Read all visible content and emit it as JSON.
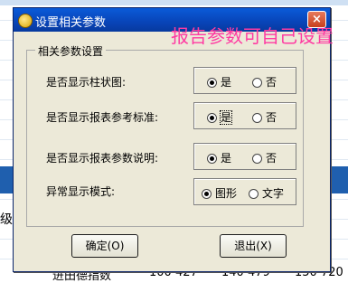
{
  "dialog": {
    "title": "设置相关参数",
    "close_label": "×"
  },
  "overlay_label": "报告参数可自己设置",
  "group": {
    "legend": "相关参数设置",
    "rows": [
      {
        "label": "是否显示柱状图:",
        "options": [
          "是",
          "否"
        ],
        "selected": "是"
      },
      {
        "label": "是否显示报表参考标准:",
        "options": [
          "是",
          "否"
        ],
        "selected": "是"
      },
      {
        "label": "是否显示报表参数说明:",
        "options": [
          "是",
          "否"
        ],
        "selected": "是"
      },
      {
        "label": "异常显示模式:",
        "options": [
          "图形",
          "文字"
        ],
        "selected": "图形"
      }
    ]
  },
  "buttons": {
    "ok_label": "确定(O)",
    "exit_label": "退出(X)"
  },
  "background": {
    "left_char": "级",
    "bottom_text_1": "进田德指数",
    "bottom_text_2": "100 427",
    "bottom_text_3": "140 479",
    "bottom_text_4": "150 720"
  },
  "colors": {
    "title_bar": "#0844b8",
    "overlay_text": "#ff3aa2",
    "dialog_bg": "#ece9d8"
  }
}
